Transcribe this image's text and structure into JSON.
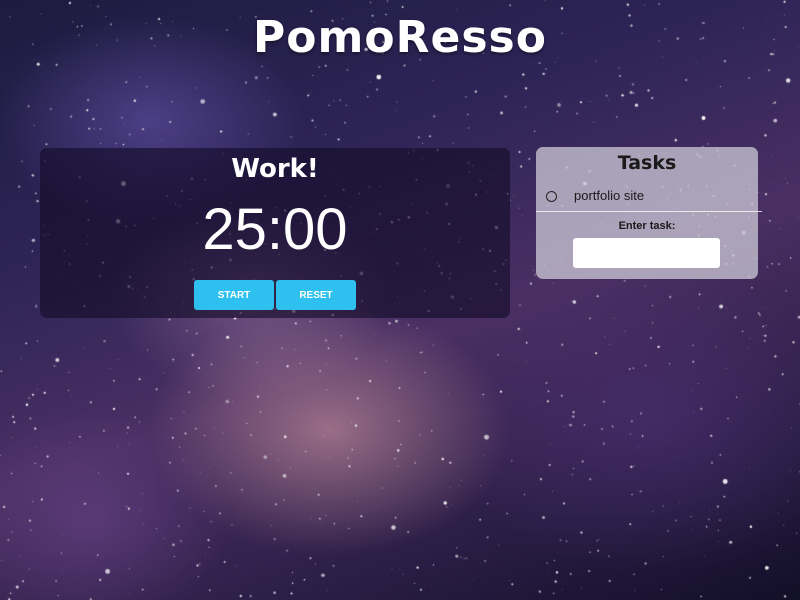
{
  "app": {
    "title": "PomoResso"
  },
  "timer": {
    "mode_label": "Work!",
    "time": "25:00",
    "start_label": "START",
    "reset_label": "RESET",
    "button_color": "#2ec0ee"
  },
  "tasks": {
    "title": "Tasks",
    "items": [
      {
        "label": "portfolio site",
        "checked": false
      }
    ],
    "enter_label": "Enter task:",
    "input_value": "",
    "input_placeholder": ""
  }
}
